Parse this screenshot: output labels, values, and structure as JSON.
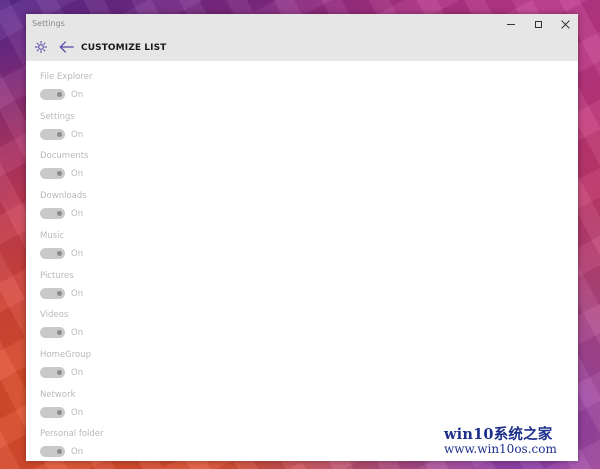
{
  "window": {
    "title": "Settings"
  },
  "header": {
    "title": "CUSTOMIZE LIST",
    "icon": "gear-icon",
    "back_icon": "back-arrow-icon",
    "accent_color": "#5b4fa8"
  },
  "settings": [
    {
      "label": "File Explorer",
      "state": "On"
    },
    {
      "label": "Settings",
      "state": "On"
    },
    {
      "label": "Documents",
      "state": "On"
    },
    {
      "label": "Downloads",
      "state": "On"
    },
    {
      "label": "Music",
      "state": "On"
    },
    {
      "label": "Pictures",
      "state": "On"
    },
    {
      "label": "Videos",
      "state": "On"
    },
    {
      "label": "HomeGroup",
      "state": "On"
    },
    {
      "label": "Network",
      "state": "On"
    },
    {
      "label": "Personal folder",
      "state": "On"
    }
  ],
  "watermark": {
    "brand": "win10系统之家",
    "url": "www.win10os.com"
  }
}
